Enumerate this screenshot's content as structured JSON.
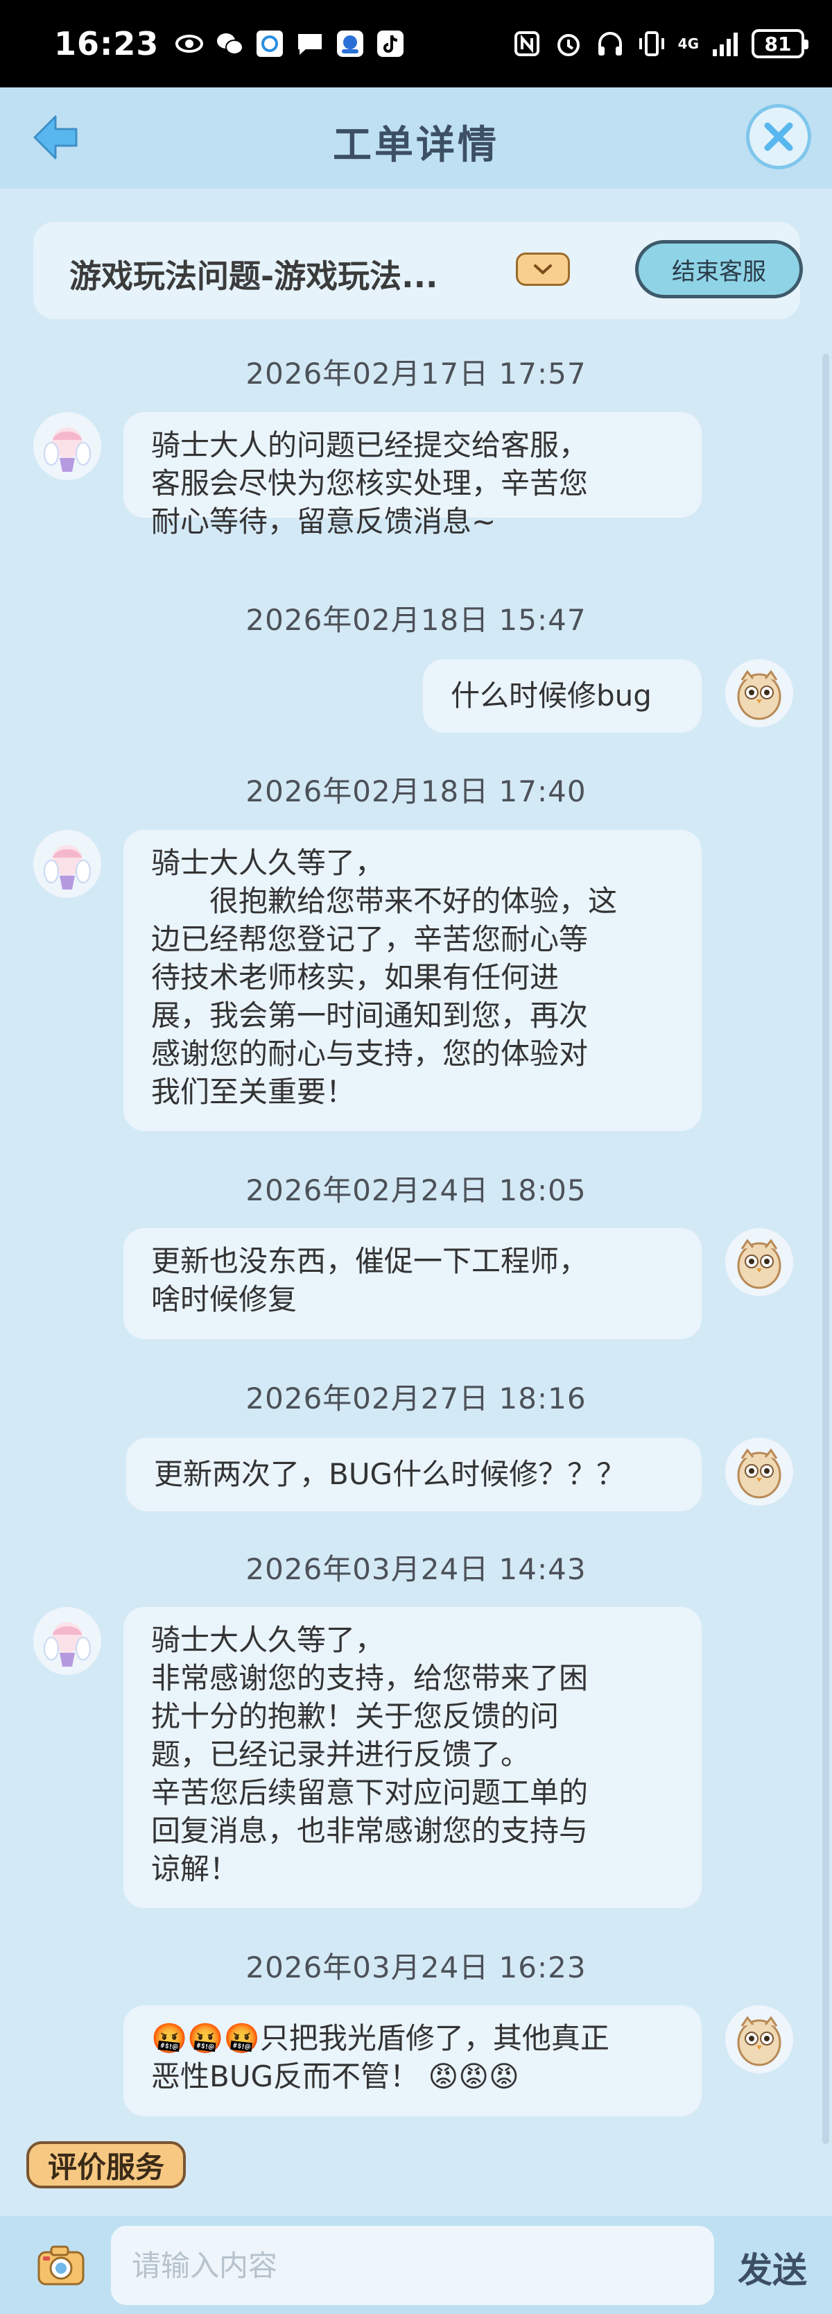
{
  "status_bar": {
    "time": "16:23",
    "network": "4G",
    "battery": "81"
  },
  "header": {
    "title": "工单详情"
  },
  "topic": {
    "title": "游戏玩法问题-游戏玩法...",
    "end_button": "结束客服"
  },
  "messages": [
    {
      "timestamp": "2026年02月17日 17:57",
      "sender": "agent",
      "text": "骑士大人的问题已经提交给客服，\n客服会尽快为您核实处理，辛苦您\n耐心等待，留意反馈消息~"
    },
    {
      "timestamp": "2026年02月18日 15:47",
      "sender": "user",
      "text": "什么时候修bug"
    },
    {
      "timestamp": "2026年02月18日 17:40",
      "sender": "agent",
      "text": "骑士大人久等了，\n　　很抱歉给您带来不好的体验，这\n边已经帮您登记了，辛苦您耐心等\n待技术老师核实，如果有任何进\n展，我会第一时间通知到您，再次\n感谢您的耐心与支持，您的体验对\n我们至关重要！"
    },
    {
      "timestamp": "2026年02月24日 18:05",
      "sender": "user",
      "text": "更新也没东西，催促一下工程师，\n啥时候修复"
    },
    {
      "timestamp": "2026年02月27日 18:16",
      "sender": "user",
      "text": "更新两次了，BUG什么时候修？？？"
    },
    {
      "timestamp": "2026年03月24日 14:43",
      "sender": "agent",
      "text": "骑士大人久等了，\n非常感谢您的支持，给您带来了困\n扰十分的抱歉！关于您反馈的问\n题，已经记录并进行反馈了。\n辛苦您后续留意下对应问题工单的\n回复消息，也非常感谢您的支持与\n谅解！"
    },
    {
      "timestamp": "2026年03月24日 16:23",
      "sender": "user",
      "text": "🤬🤬🤬只把我光盾修了，其他真正\n恶性BUG反而不管！ 😡😡😡"
    }
  ],
  "rate_button": "评价服务",
  "input": {
    "placeholder": "请输入内容",
    "send_label": "发送"
  },
  "colors": {
    "background": "#d4e9f6",
    "header": "#bfe0f3",
    "bubble": "#eaf4fb",
    "accent": "#8fd3e6"
  }
}
